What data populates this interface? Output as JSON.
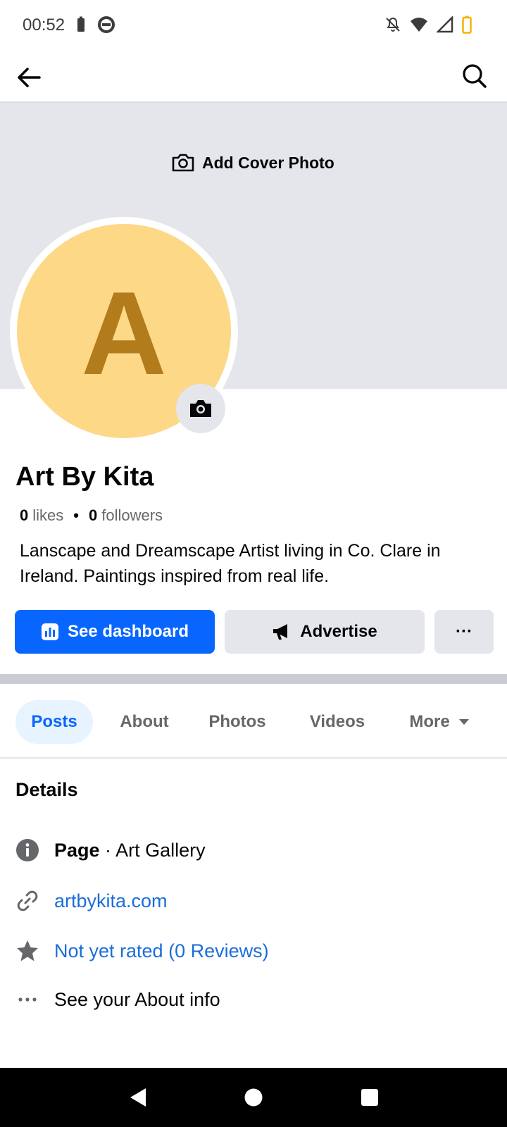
{
  "status_bar": {
    "time": "00:52",
    "left_icons": [
      "battery-saver-icon",
      "data-saver-icon"
    ],
    "right_icons": [
      "notifications-off-icon",
      "wifi-icon",
      "cell-signal-icon",
      "battery-low-icon"
    ],
    "battery_color": "#f4b400"
  },
  "app_bar": {
    "back_icon": "arrow-left-icon",
    "search_icon": "search-icon"
  },
  "cover": {
    "add_cover_label": "Add Cover Photo",
    "background": "#e4e6eb"
  },
  "profile": {
    "avatar_letter": "A",
    "avatar_bg": "#fcd887",
    "avatar_fg": "#b27b1b",
    "name": "Art By Kita",
    "likes_count": "0",
    "likes_label": "likes",
    "followers_count": "0",
    "followers_label": "followers",
    "bio": "Lanscape and Dreamscape Artist living in Co. Clare in Ireland. Paintings inspired from real life."
  },
  "actions": {
    "dashboard_label": "See dashboard",
    "advertise_label": "Advertise",
    "more_label": "···",
    "primary_color": "#0866ff"
  },
  "tabs": {
    "posts": "Posts",
    "about": "About",
    "photos": "Photos",
    "videos": "Videos",
    "more": "More",
    "active": "Posts"
  },
  "details": {
    "title": "Details",
    "page_label": "Page",
    "page_separator": " · ",
    "page_category": "Art Gallery",
    "website": "artbykita.com",
    "rating": "Not yet rated (0 Reviews)",
    "about_info": "See your About info",
    "link_color": "#1a6ed8"
  }
}
